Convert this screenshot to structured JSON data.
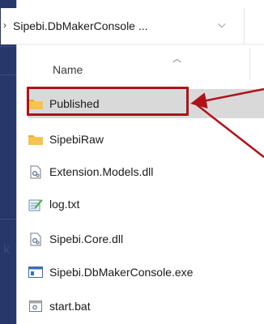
{
  "explorer": {
    "address_path": "Sipebi.DbMakerConsole ...",
    "column_header": "Name",
    "files": [
      {
        "name": "Published",
        "icon": "folder-icon",
        "selected": true
      },
      {
        "name": "SipebiRaw",
        "icon": "folder-icon",
        "selected": false
      },
      {
        "name": "Extension.Models.dll",
        "icon": "dll-file-icon",
        "selected": false
      },
      {
        "name": "log.txt",
        "icon": "text-file-icon",
        "selected": false
      },
      {
        "name": "Sipebi.Core.dll",
        "icon": "dll-file-icon",
        "selected": false
      },
      {
        "name": "Sipebi.DbMakerConsole.exe",
        "icon": "exe-file-icon",
        "selected": false
      },
      {
        "name": "start.bat",
        "icon": "bat-file-icon",
        "selected": false
      }
    ]
  },
  "colors": {
    "annotation": "#b0121a",
    "folder": "#f2c14e",
    "selection": "#d9d9d9",
    "background": "#27376a"
  }
}
